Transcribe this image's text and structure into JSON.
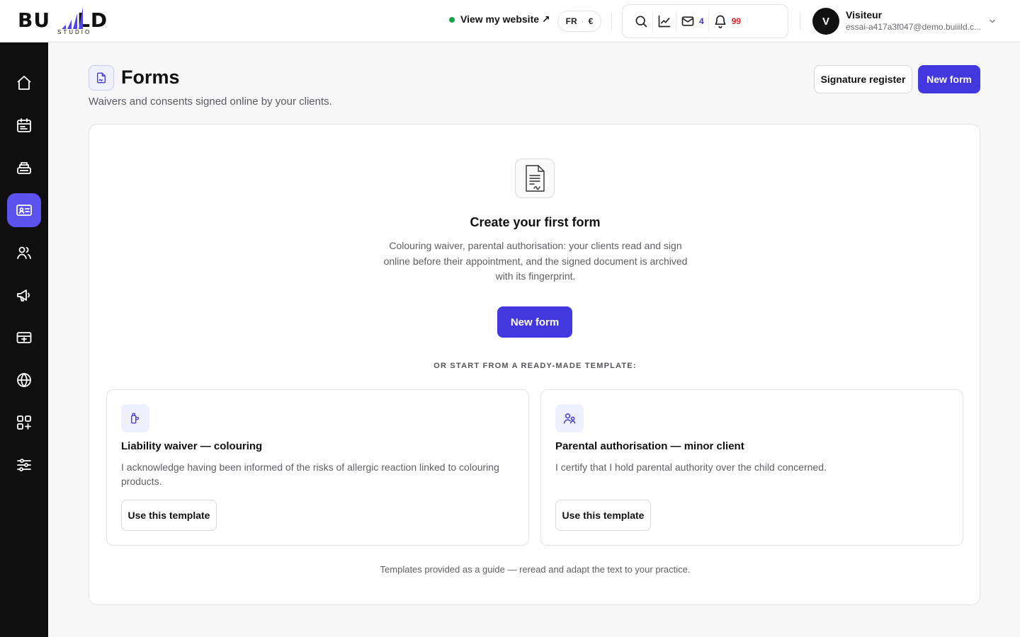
{
  "brand": {
    "name_left": "BU",
    "name_right": "LD",
    "subtitle": "STUDIO"
  },
  "header": {
    "site_link": "View my website ↗",
    "locale": {
      "language": "FR",
      "currency": "€"
    },
    "messages_count": "4",
    "notifications_count": "99",
    "user": {
      "initial": "V",
      "name": "Visiteur",
      "email": "essai-a417a3f047@demo.buiiild.c..."
    }
  },
  "sidebar": {
    "items": [
      {
        "icon": "home-icon",
        "active": false
      },
      {
        "icon": "calendar-icon",
        "active": false
      },
      {
        "icon": "register-icon",
        "active": false
      },
      {
        "icon": "id-card-icon",
        "active": true
      },
      {
        "icon": "users-icon",
        "active": false
      },
      {
        "icon": "megaphone-icon",
        "active": false
      },
      {
        "icon": "payment-icon",
        "active": false
      },
      {
        "icon": "globe-icon",
        "active": false
      },
      {
        "icon": "apps-add-icon",
        "active": false
      },
      {
        "icon": "sliders-icon",
        "active": false
      }
    ]
  },
  "page": {
    "title": "Forms",
    "subtitle": "Waivers and consents signed online by your clients.",
    "signature_register_label": "Signature register",
    "new_form_label": "New form"
  },
  "empty_state": {
    "title": "Create your first form",
    "description": "Colouring waiver, parental authorisation: your clients read and sign online before their appointment, and the signed document is archived with its fingerprint.",
    "button_label": "New form",
    "templates_label": "OR START FROM A READY-MADE TEMPLATE:"
  },
  "templates": [
    {
      "title": "Liability waiver — colouring",
      "description": "I acknowledge having been informed of the risks of allergic reaction linked to colouring products.",
      "button_label": "Use this template"
    },
    {
      "title": "Parental authorisation — minor client",
      "description": "I certify that I hold parental authority over the child concerned.",
      "button_label": "Use this template"
    }
  ],
  "footer_note": "Templates provided as a guide — reread and adapt the text to your practice.",
  "colors": {
    "accent": "#4338e0",
    "active_nav": "#5b52f0",
    "sidebar_bg": "#0f0f10",
    "online_dot": "#16a34a",
    "notification": "#dc2626"
  }
}
